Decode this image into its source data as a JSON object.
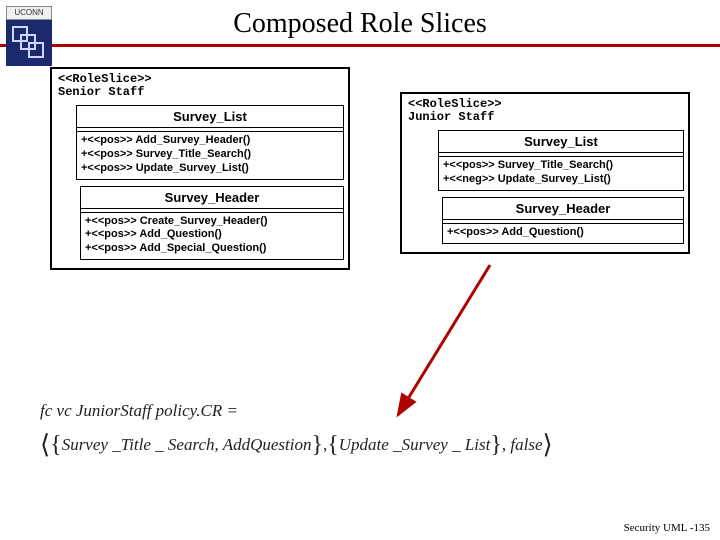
{
  "header": {
    "title": "Composed Role Slices",
    "logo_text": "UCONN"
  },
  "senior": {
    "stereotype": "<<RoleSlice>>",
    "name": "Senior Staff",
    "classes": [
      {
        "name": "Survey_List",
        "ops": [
          "+<<pos>> Add_Survey_Header()",
          "+<<pos>> Survey_Title_Search()",
          "+<<pos>> Update_Survey_List()"
        ]
      },
      {
        "name": "Survey_Header",
        "ops": [
          "+<<pos>> Create_Survey_Header()",
          "+<<pos>> Add_Question()",
          "+<<pos>> Add_Special_Question()"
        ]
      }
    ]
  },
  "junior": {
    "stereotype": "<<RoleSlice>>",
    "name": "Junior Staff",
    "classes": [
      {
        "name": "Survey_List",
        "ops": [
          "+<<pos>> Survey_Title_Search()",
          "+<<neg>> Update_Survey_List()"
        ]
      },
      {
        "name": "Survey_Header",
        "ops": [
          "+<<pos>> Add_Question()"
        ]
      }
    ]
  },
  "formula": {
    "line1": "fc vc JuniorStaff  policy.CR =",
    "lhs_set": "Survey _Title _ Search, AddQuestion",
    "rhs_set": "Update _Survey _ List",
    "tail": "false"
  },
  "footer": "Security UML -135"
}
